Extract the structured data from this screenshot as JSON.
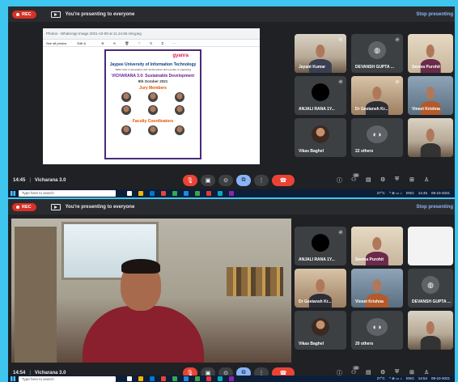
{
  "panel1": {
    "rec_label": "REC",
    "presenting_text": "You're presenting to everyone",
    "stop_label": "Stop presenting",
    "time": "14:45",
    "meeting_name": "Vicharana 3.0",
    "browser": {
      "title": "Photos - WhatsApp Image 2021-10-08 at 11.24.56 AM.jpeg",
      "tab_label": "See all photos",
      "edit_label": "Edit &"
    },
    "poster": {
      "brand": "gyanra",
      "university": "Jaypee University of Information Technology",
      "subtitle": "TEDC Club in association with Technovators and e-polise is organizing",
      "event": "VICHARANA 3.0: Sustainable Development",
      "date": "9th October 2021",
      "jury_heading": "Jury Members",
      "coord_heading": "Faculty Coordinators"
    },
    "tiles": [
      {
        "name": "Jayant Kumar"
      },
      {
        "name": "DEVANSH GUPTA ..."
      },
      {
        "name": "Seema Purohit"
      },
      {
        "name": "ANJALI RANA 1Y..."
      },
      {
        "name": "Dr Geetansh Kr..."
      },
      {
        "name": "Vineet Krishna"
      },
      {
        "name": "Vikas Baghel"
      },
      {
        "name": "22 others"
      },
      {
        "name": ""
      }
    ],
    "people_count": "25"
  },
  "taskbar1": {
    "search_placeholder": "Type here to search",
    "temp": "27°C",
    "lang": "ENG",
    "clock": "14:45",
    "date": "09-10-2021"
  },
  "panel2": {
    "rec_label": "REC",
    "presenting_text": "You're presenting to everyone",
    "stop_label": "Stop presenting",
    "time": "14:54",
    "meeting_name": "Vicharana 3.0",
    "tiles": [
      {
        "name": "ANJALI RANA 1Y..."
      },
      {
        "name": "Seema Purohit"
      },
      {
        "name": ""
      },
      {
        "name": "Dr Geetansh Kr..."
      },
      {
        "name": "Vineet Krishna"
      },
      {
        "name": "DEVANSH GUPTA ..."
      },
      {
        "name": "Vikas Baghel"
      },
      {
        "name": "20 others"
      },
      {
        "name": ""
      }
    ],
    "people_count": "29"
  },
  "taskbar2": {
    "search_placeholder": "Type here to search",
    "temp": "27°C",
    "lang": "ENG",
    "clock": "14:54",
    "date": "09-10-2021"
  },
  "colors": {
    "background": "#3ec6ef",
    "meet_dark": "#202124",
    "rec_red": "#d93025",
    "end_call_red": "#ea4335",
    "accent_blue": "#8ab4f8"
  }
}
